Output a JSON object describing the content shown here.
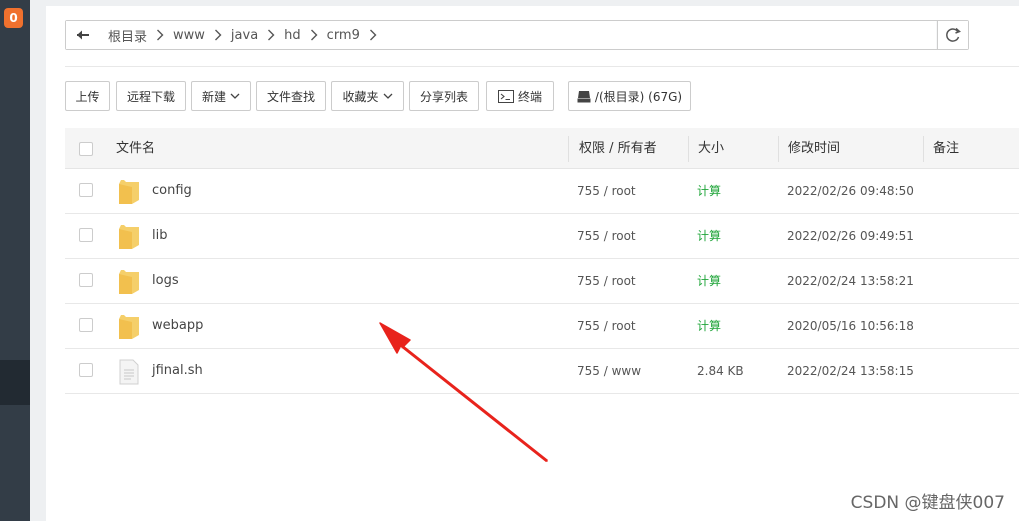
{
  "sidebar": {
    "badge_count": "0"
  },
  "breadcrumb": [
    "根目录",
    "www",
    "java",
    "hd",
    "crm9"
  ],
  "toolbar": {
    "upload": "上传",
    "remote_download": "远程下载",
    "new": "新建",
    "file_search": "文件查找",
    "favorites": "收藏夹",
    "share_list": "分享列表",
    "terminal": "终端",
    "disk": "/(根目录) (67G)"
  },
  "table": {
    "headers": {
      "name": "文件名",
      "perm_owner": "权限 / 所有者",
      "size": "大小",
      "mtime": "修改时间",
      "remark": "备注"
    },
    "rows": [
      {
        "type": "folder",
        "name": "config",
        "perm": "755 / root",
        "size": "计算",
        "mtime": "2022/02/26 09:48:50"
      },
      {
        "type": "folder",
        "name": "lib",
        "perm": "755 / root",
        "size": "计算",
        "mtime": "2022/02/26 09:49:51"
      },
      {
        "type": "folder",
        "name": "logs",
        "perm": "755 / root",
        "size": "计算",
        "mtime": "2022/02/24 13:58:21"
      },
      {
        "type": "folder",
        "name": "webapp",
        "perm": "755 / root",
        "size": "计算",
        "mtime": "2020/05/16 10:56:18"
      },
      {
        "type": "file",
        "name": "jfinal.sh",
        "perm": "755 / www",
        "size": "2.84 KB",
        "mtime": "2022/02/24 13:58:15"
      }
    ]
  },
  "watermark": "CSDN @键盘侠007",
  "colors": {
    "sidebar": "#333d47",
    "badge": "#f0712e",
    "calc_link": "#20a53a",
    "folder": "#f5cf6a",
    "arrow": "#e8231c"
  },
  "icons": {
    "back": "arrow-left-icon",
    "refresh": "refresh-icon",
    "terminal": "terminal-icon",
    "disk": "disk-icon",
    "folder": "folder-icon",
    "file": "file-icon"
  }
}
